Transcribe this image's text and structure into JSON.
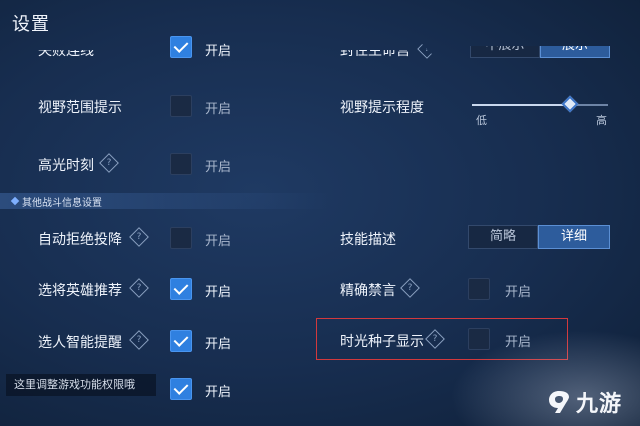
{
  "header": {
    "title": "设置"
  },
  "left_rows": [
    {
      "label": "失败连线",
      "state": "开启",
      "checked": true
    },
    {
      "label": "视野范围提示",
      "state": "开启",
      "checked": false
    },
    {
      "label": "高光时刻",
      "state": "开启",
      "checked": false
    },
    {
      "label": "自动拒绝投降",
      "state": "开启",
      "checked": false
    },
    {
      "label": "选将英雄推荐",
      "state": "开启",
      "checked": true
    },
    {
      "label": "选人智能提醒",
      "state": "开启",
      "checked": true
    },
    {
      "label": "",
      "state": "开启",
      "checked": true
    }
  ],
  "section": {
    "title": "其他战斗信息设置"
  },
  "right": {
    "top_label": "封住主命宫",
    "top_seg": {
      "off": "不展示",
      "on": "展示"
    },
    "vision_label": "视野提示程度",
    "vision_min": "低",
    "vision_max": "高",
    "vision_level": 0.72,
    "skill_label": "技能描述",
    "skill_seg": {
      "off": "简略",
      "on": "详细"
    },
    "mute_label": "精确禁言",
    "mute_state": "开启",
    "seed_label": "时光种子显示",
    "seed_state": "开启"
  },
  "tooltip": {
    "text": "这里调整游戏功能权限哦"
  },
  "watermark": {
    "text": "九游"
  },
  "colors": {
    "accent": "#2f80e0",
    "highlight": "#d2393d"
  }
}
